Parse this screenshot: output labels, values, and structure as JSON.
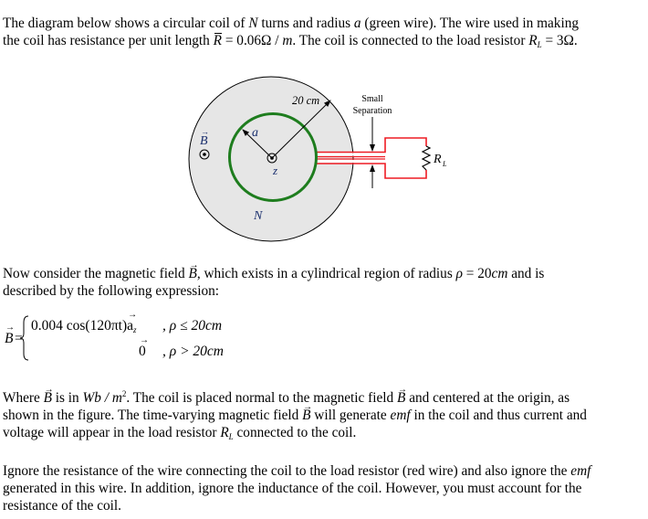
{
  "intro": {
    "line1_parts": [
      "The diagram below shows a circular coil of ",
      "N",
      " turns and radius ",
      "a",
      " (green wire). The wire used in making"
    ],
    "line2_parts": [
      "the coil has resistance per unit length ",
      "R",
      " = 0.06Ω / ",
      "m",
      ". The coil is connected to the load resistor ",
      "R",
      "L",
      " = 3Ω."
    ]
  },
  "diagram": {
    "field_label": "B",
    "field_symbol": "out-of-page-dot-icon",
    "radius_label": "20 cm",
    "coil_radius_label": "a",
    "center_label": "z",
    "turns_label": "N",
    "separation_label_line1": "Small",
    "separation_label_line2": "Separation",
    "resistor_label": "R",
    "resistor_subscript": "L",
    "colors": {
      "region_fill": "#e6e6e6",
      "coil": "#1e7d1e",
      "wire": "#ee1c24",
      "label": "#1a2f6e"
    }
  },
  "field_intro": {
    "line1_parts": [
      "Now consider the magnetic field ",
      "B",
      ", which exists in a cylindrical region of radius ",
      "ρ",
      " = 20",
      "cm",
      " and is"
    ],
    "line2": "described by the following expression:"
  },
  "equation": {
    "lhs": "B",
    "case1_expr": "0.004 cos(120πt)",
    "case1_unit_vec": "a",
    "case1_unit_sub": "z",
    "case1_cond": ", ρ ≤ 20cm",
    "case2_expr": "0",
    "case2_cond": ", ρ > 20cm"
  },
  "where_para": {
    "line1_parts": [
      "Where ",
      "B",
      " is in ",
      "Wb / m",
      "2",
      ". The coil is placed normal to the magnetic field ",
      "B",
      " and centered at the origin, as"
    ],
    "line2_parts": [
      "shown in the figure. The time-varying magnetic field ",
      "B",
      " will generate ",
      "emf",
      " in the coil and thus current and"
    ],
    "line3_parts": [
      "voltage will appear in the load resistor ",
      "R",
      "L",
      " connected to the coil."
    ]
  },
  "ignore_para": {
    "line1_parts": [
      "Ignore the resistance of the wire connecting the coil to the load resistor (red wire) and also ignore the ",
      "emf"
    ],
    "line2": "generated in this wire. In addition, ignore the inductance of the coil. However, you must account for the",
    "line3": "resistance of the coil."
  }
}
